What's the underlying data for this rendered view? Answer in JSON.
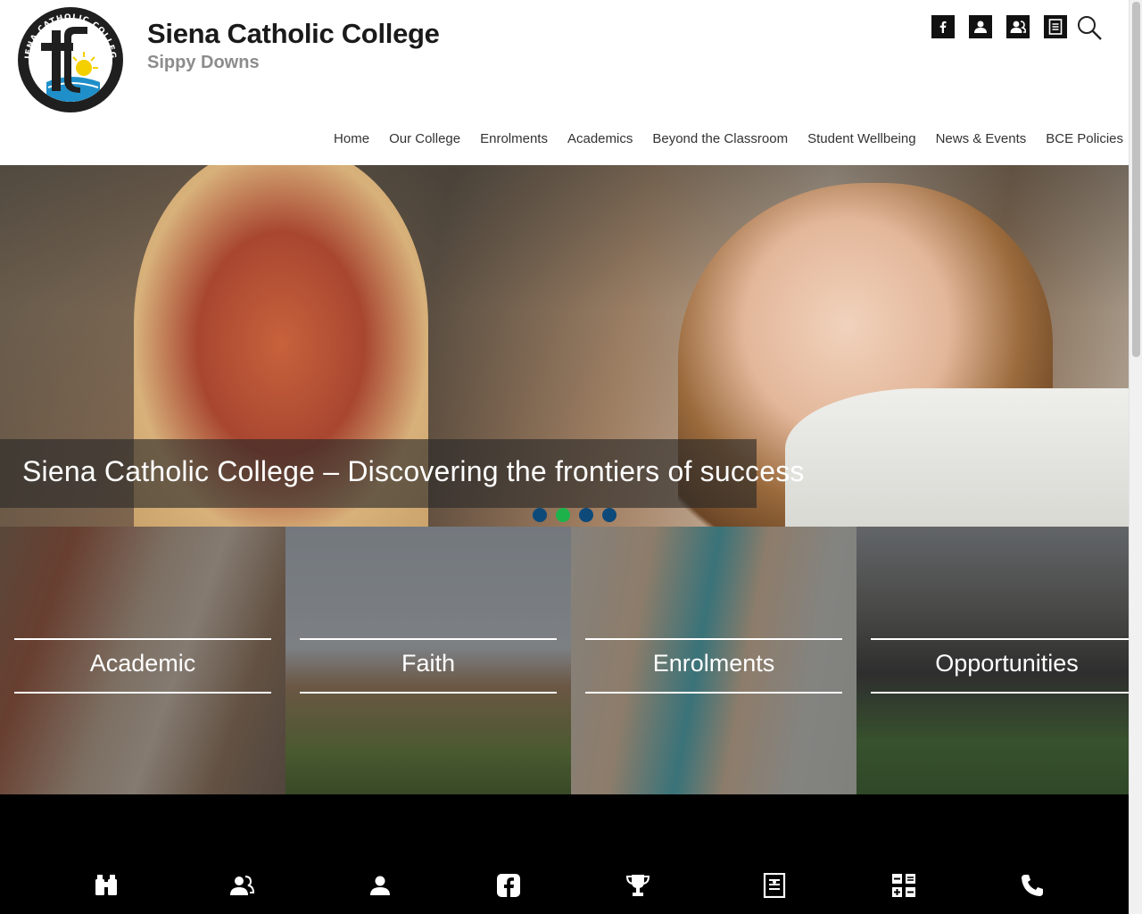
{
  "header": {
    "title": "Siena Catholic College",
    "subtitle": "Sippy Downs",
    "logo_text": "SIENA CATHOLIC COLLEGE",
    "util_icons": [
      "facebook-icon",
      "user-icon",
      "users-icon",
      "document-icon"
    ],
    "search_icon": "search-icon"
  },
  "nav": {
    "items": [
      "Home",
      "Our College",
      "Enrolments",
      "Academics",
      "Beyond the Classroom",
      "Student Wellbeing",
      "News & Events",
      "BCE Policies"
    ]
  },
  "hero": {
    "caption": "Siena Catholic College – Discovering the frontiers of success",
    "slides": 4,
    "active_slide": 2,
    "dot_color": "#0d4a7a",
    "active_dot_color": "#1db34a"
  },
  "tiles": [
    {
      "label": "Academic"
    },
    {
      "label": "Faith"
    },
    {
      "label": "Enrolments"
    },
    {
      "label": "Opportunities"
    }
  ],
  "footer": {
    "icons": [
      "binoculars-icon",
      "user-group-icon",
      "user-icon",
      "facebook-icon",
      "trophy-icon",
      "document-icon",
      "calculator-icon",
      "phone-icon"
    ]
  },
  "colors": {
    "footer_bg": "#000000",
    "title": "#1a1a1a",
    "subtitle": "#8c8c8c"
  }
}
